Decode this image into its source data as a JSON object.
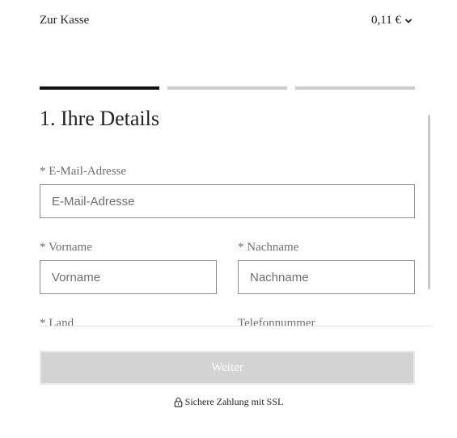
{
  "header": {
    "title": "Zur Kasse",
    "total": "0,11 €"
  },
  "steps": {
    "count": 3,
    "active_index": 1
  },
  "section": {
    "title": "1. Ihre Details"
  },
  "form": {
    "email": {
      "label": "* E-Mail-Adresse",
      "placeholder": "E-Mail-Adresse",
      "value": ""
    },
    "first_name": {
      "label": "* Vorname",
      "placeholder": "Vorname",
      "value": ""
    },
    "last_name": {
      "label": "* Nachname",
      "placeholder": "Nachname",
      "value": ""
    },
    "country": {
      "label": "* Land"
    },
    "phone": {
      "label": "Telefonnummer"
    }
  },
  "actions": {
    "next_label": "Weiter"
  },
  "footer": {
    "ssl_text": "Sichere Zahlung mit SSL"
  },
  "colors": {
    "step_active": "#111111",
    "step_inactive": "#cccccc",
    "button_disabled": "#d3d3d3"
  },
  "icons": {
    "total_toggle": "chevron-down-icon",
    "ssl": "lock-icon"
  }
}
